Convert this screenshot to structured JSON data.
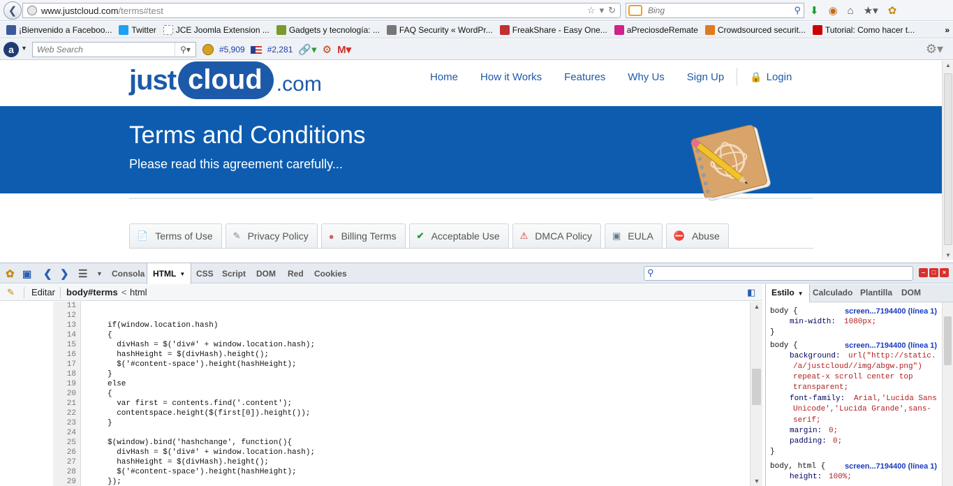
{
  "browser": {
    "url_domain": "www.justcloud.com",
    "url_path": "/terms#test",
    "search_placeholder": "Bing",
    "bookmarks": [
      {
        "label": "¡Bienvenido a Faceboo...",
        "icon": "facebook-icon",
        "color": "#3b5998"
      },
      {
        "label": "Twitter",
        "icon": "twitter-icon",
        "color": "#1da1f2"
      },
      {
        "label": "JCE Joomla Extension ...",
        "icon": "page-icon",
        "color": "#ffffff"
      },
      {
        "label": "Gadgets y tecnología: ...",
        "icon": "gadgets-icon",
        "color": "#7a9a2a"
      },
      {
        "label": "FAQ Security « WordPr...",
        "icon": "wordpress-icon",
        "color": "#777777"
      },
      {
        "label": "FreakShare - Easy One...",
        "icon": "freakshare-icon",
        "color": "#c03030"
      },
      {
        "label": "aPreciosdeRemate",
        "icon": "exclamation-icon",
        "color": "#d0208a"
      },
      {
        "label": "Crowdsourced securit...",
        "icon": "crowd-icon",
        "color": "#e07a20"
      },
      {
        "label": "Tutorial: Como hacer t...",
        "icon": "youtube-icon",
        "color": "#cc0000"
      }
    ],
    "addon": {
      "web_search_placeholder": "Web Search",
      "rank_world": "#5,909",
      "rank_us": "#2,281"
    }
  },
  "site": {
    "logo": {
      "just": "just",
      "cloud": "cloud",
      "com": ".com"
    },
    "nav": [
      "Home",
      "How it Works",
      "Features",
      "Why Us",
      "Sign Up"
    ],
    "login": "Login",
    "banner_title": "Terms and Conditions",
    "banner_subtitle": "Please read this agreement carefully...",
    "tabs": [
      {
        "label": "Terms of Use",
        "icon": "document-icon"
      },
      {
        "label": "Privacy Policy",
        "icon": "pen-icon"
      },
      {
        "label": "Billing Terms",
        "icon": "piggy-bank-icon"
      },
      {
        "label": "Acceptable Use",
        "icon": "checkmark-icon"
      },
      {
        "label": "DMCA Policy",
        "icon": "warning-icon"
      },
      {
        "label": "EULA",
        "icon": "monitor-icon"
      },
      {
        "label": "Abuse",
        "icon": "stop-icon"
      }
    ],
    "accent": "#1c5aa9",
    "banner_color": "#0d5cb0"
  },
  "firebug": {
    "tabs": [
      "Consola",
      "HTML",
      "CSS",
      "Script",
      "DOM",
      "Red",
      "Cookies"
    ],
    "active_tab": "HTML",
    "edit_label": "Editar",
    "breadcrumb_current": "body#terms",
    "breadcrumb_sep": "<",
    "breadcrumb_parent": "html",
    "side_tabs": [
      "Estilo",
      "Calculado",
      "Plantilla",
      "DOM"
    ],
    "code_lines": [
      {
        "n": "11",
        "text": ""
      },
      {
        "n": "12",
        "text": ""
      },
      {
        "n": "13",
        "text": "if(window.location.hash)"
      },
      {
        "n": "14",
        "text": "{"
      },
      {
        "n": "15",
        "text": "  divHash = $('div#' + window.location.hash);"
      },
      {
        "n": "16",
        "text": "  hashHeight = $(divHash).height();"
      },
      {
        "n": "17",
        "text": "  $('#content-space').height(hashHeight);"
      },
      {
        "n": "18",
        "text": "}"
      },
      {
        "n": "19",
        "text": "else"
      },
      {
        "n": "20",
        "text": "{"
      },
      {
        "n": "21",
        "text": "  var first = contents.find('.content');"
      },
      {
        "n": "22",
        "text": "  contentspace.height($(first[0]).height());"
      },
      {
        "n": "23",
        "text": "}"
      },
      {
        "n": "24",
        "text": ""
      },
      {
        "n": "25",
        "text": "$(window).bind('hashchange', function(){"
      },
      {
        "n": "26",
        "text": "  divHash = $('div#' + window.location.hash);"
      },
      {
        "n": "27",
        "text": "  hashHeight = $(divHash).height();"
      },
      {
        "n": "28",
        "text": "  $('#content-space').height(hashHeight);"
      },
      {
        "n": "29",
        "text": "});"
      }
    ],
    "style_source": "screen...7194400 (línea 1)",
    "style_rules": {
      "r1_sel": "body {",
      "r1_prop": "min-width:",
      "r1_val": "1080px;",
      "close": "}",
      "r2_sel": "body {",
      "r2_p1": "background:",
      "r2_v1a": "url(\"http://static.",
      "r2_v1b": "/a/justcloud//img/abgw.png\")",
      "r2_v1c": "repeat-x scroll center top",
      "r2_v1d": "transparent;",
      "r2_p2": "font-family:",
      "r2_v2a": "Arial,'Lucida Sans",
      "r2_v2b": "Unicode','Lucida Grande',sans-",
      "r2_v2c": "serif;",
      "r2_p3": "margin:",
      "r2_v3": "0;",
      "r2_p4": "padding:",
      "r2_v4": "0;",
      "r3_sel": "body, html {",
      "r3_prop": "height:",
      "r3_val": "100%;"
    }
  }
}
